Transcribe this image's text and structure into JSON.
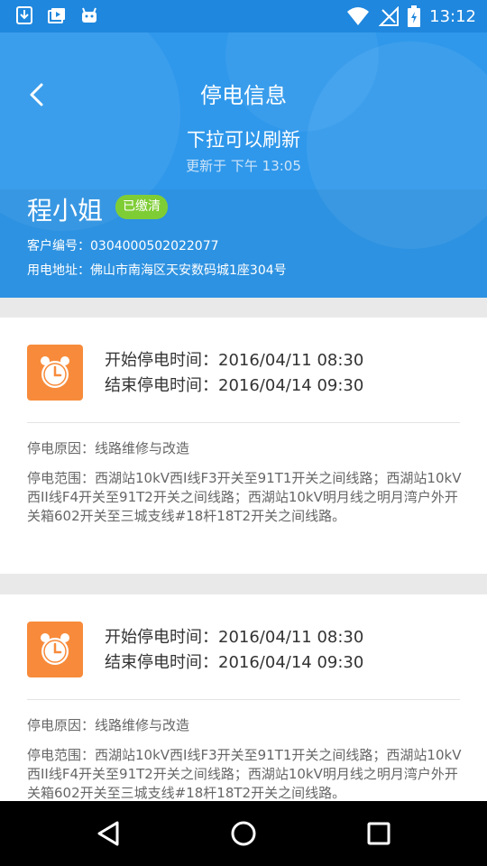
{
  "status_bar": {
    "icons_left": [
      "download-icon",
      "gallery-icon",
      "android-icon"
    ],
    "icons_right": [
      "wifi-icon",
      "no-sim-icon",
      "battery-charging-icon"
    ],
    "time": "13:12"
  },
  "header": {
    "title": "停电信息",
    "pull_refresh": "下拉可以刷新",
    "updated": "更新于 下午 13:05"
  },
  "customer": {
    "name": "程小姐",
    "badge": "已缴清",
    "customer_no": "客户编号：0304000502022077",
    "address": "用电地址：佛山市南海区天安数码城1座304号"
  },
  "outages": [
    {
      "start": "开始停电时间：2016/04/11 08:30",
      "end": "结束停电时间：2016/04/14 09:30",
      "reason": "停电原因：线路维修与改造",
      "scope": "停电范围：西湖站10kV西I线F3开关至91T1开关之间线路；西湖站10kV西II线F4开关至91T2开关之间线路；西湖站10kV明月线之明月湾户外开关箱602开关至三城支线#18杆18T2开关之间线路。"
    },
    {
      "start": "开始停电时间：2016/04/11 08:30",
      "end": "结束停电时间：2016/04/14 09:30",
      "reason": "停电原因：线路维修与改造",
      "scope": "停电范围：西湖站10kV西I线F3开关至91T1开关之间线路；西湖站10kV西II线F4开关至91T2开关之间线路；西湖站10kV明月线之明月湾户外开关箱602开关至三城支线#18杆18T2开关之间线路。"
    }
  ],
  "colors": {
    "header_blue": "#2f98eb",
    "badge_green": "#7fcd35",
    "clock_orange": "#f78b3b"
  }
}
